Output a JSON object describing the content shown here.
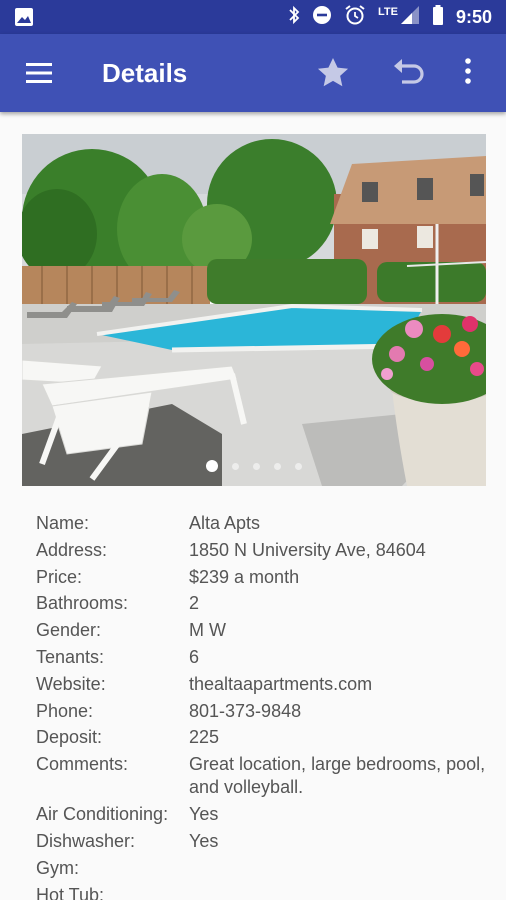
{
  "status_bar": {
    "time": "9:50",
    "network": "LTE",
    "icons": [
      "image-icon",
      "bluetooth-icon",
      "do-not-disturb-icon",
      "alarm-icon",
      "signal-icon",
      "battery-icon"
    ]
  },
  "app_bar": {
    "title": "Details",
    "background": "#3f51b5",
    "status_background": "#2b3a9a",
    "icons": [
      "menu-icon",
      "star-icon",
      "undo-icon",
      "more-vert-icon"
    ]
  },
  "gallery": {
    "image": "apartment-pool-photo",
    "page_count": 5,
    "active_page": 1
  },
  "details": [
    {
      "label": "Name:",
      "value": "Alta Apts"
    },
    {
      "label": "Address:",
      "value": "1850 N University Ave, 84604"
    },
    {
      "label": "Price:",
      "value": "$239 a month"
    },
    {
      "label": "Bathrooms:",
      "value": "2"
    },
    {
      "label": "Gender:",
      "value": "M W"
    },
    {
      "label": "Tenants:",
      "value": "6"
    },
    {
      "label": "Website:",
      "value": "thealtaapartments.com"
    },
    {
      "label": "Phone:",
      "value": "801-373-9848"
    },
    {
      "label": "Deposit:",
      "value": "225"
    },
    {
      "label": "Comments:",
      "value": "Great location, large bedrooms, pool, and volleyball."
    },
    {
      "label": "Air Conditioning:",
      "value": "Yes"
    },
    {
      "label": "Dishwasher:",
      "value": "Yes"
    },
    {
      "label": "Gym:",
      "value": ""
    },
    {
      "label": "Hot Tub:",
      "value": ""
    }
  ]
}
